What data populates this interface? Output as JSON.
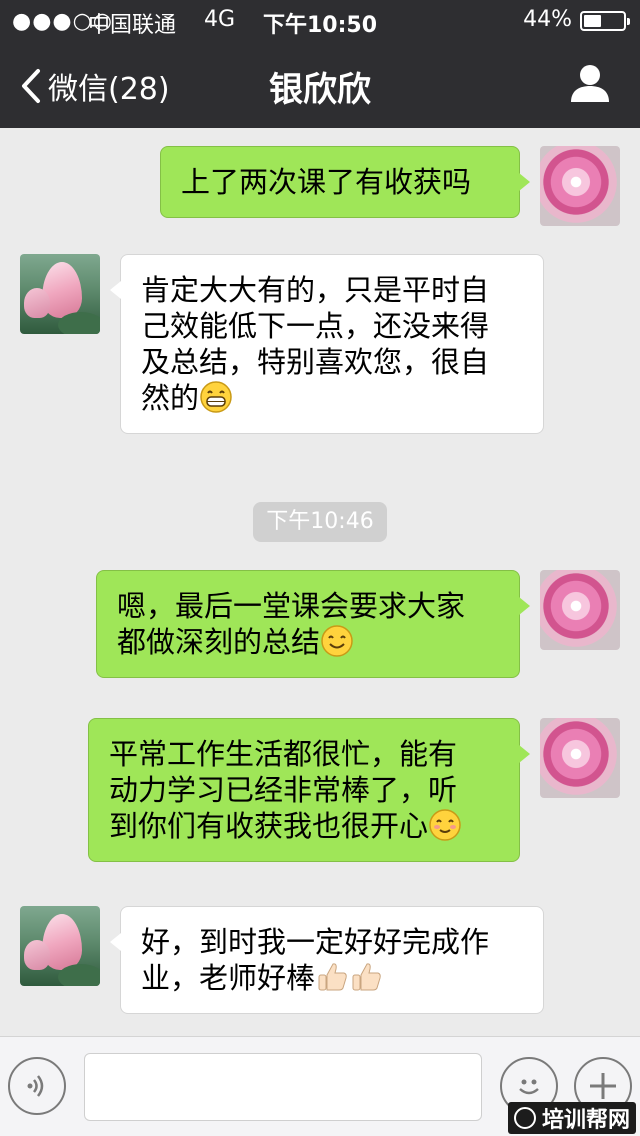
{
  "status_bar": {
    "signal": "●●●○○",
    "carrier": "中国联通",
    "network": "4G",
    "time": "下午10:50",
    "battery_percent": "44%",
    "battery_level": 0.44
  },
  "nav": {
    "back_label": "微信(28)",
    "title": "银欣欣"
  },
  "messages": [
    {
      "direction": "out",
      "text": "上了两次课了有收获吗",
      "avatar": "flower-icon"
    },
    {
      "direction": "in",
      "lines": [
        "肯定大大有的，只是平时自",
        "己效能低下一点，还没来得",
        "及总结，特别喜欢您，很自",
        "然的"
      ],
      "emoji": "grin-emoji",
      "avatar": "lotus-icon"
    },
    {
      "direction": "out",
      "lines": [
        "嗯，最后一堂课会要求大家",
        "都做深刻的总结"
      ],
      "emoji": "smile-emoji",
      "avatar": "flower-icon"
    },
    {
      "direction": "out",
      "lines": [
        "平常工作生活都很忙，能有",
        "动力学习已经非常棒了，听",
        "到你们有收获我也很开心"
      ],
      "emoji": "blush-emoji",
      "avatar": "flower-icon"
    },
    {
      "direction": "in",
      "lines": [
        "好，到时我一定好好完成作",
        "业，老师好棒"
      ],
      "emoji": "thumbs-up-emoji x2",
      "avatar": "lotus-icon"
    }
  ],
  "timestamp": "下午10:46",
  "watermark": "培训帮网",
  "colors": {
    "bar": "#2e2e31",
    "outgoing_bubble": "#9fe658",
    "incoming_bubble": "#ffffff",
    "chat_bg": "#ebebeb"
  }
}
